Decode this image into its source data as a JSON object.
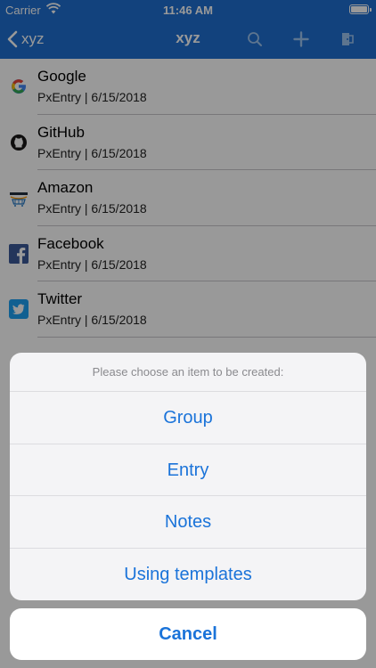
{
  "status_bar": {
    "carrier": "Carrier",
    "time": "11:46 AM"
  },
  "nav": {
    "back_label": "xyz",
    "title": "xyz",
    "icons": [
      "search-icon",
      "plus-icon",
      "logout-icon"
    ]
  },
  "entries": [
    {
      "title": "Google",
      "subtitle": "PxEntry | 6/15/2018",
      "icon": "google-icon"
    },
    {
      "title": "GitHub",
      "subtitle": "PxEntry | 6/15/2018",
      "icon": "github-icon"
    },
    {
      "title": "Amazon",
      "subtitle": "PxEntry | 6/15/2018",
      "icon": "amazon-icon"
    },
    {
      "title": "Facebook",
      "subtitle": "PxEntry | 6/15/2018",
      "icon": "facebook-icon"
    },
    {
      "title": "Twitter",
      "subtitle": "PxEntry | 6/15/2018",
      "icon": "twitter-icon"
    }
  ],
  "action_sheet": {
    "message": "Please choose an item to be created:",
    "actions": [
      "Group",
      "Entry",
      "Notes",
      "Using templates"
    ],
    "cancel_label": "Cancel"
  },
  "colors": {
    "nav_background": "#1f6fd0",
    "action_tint": "#1a73d9"
  }
}
